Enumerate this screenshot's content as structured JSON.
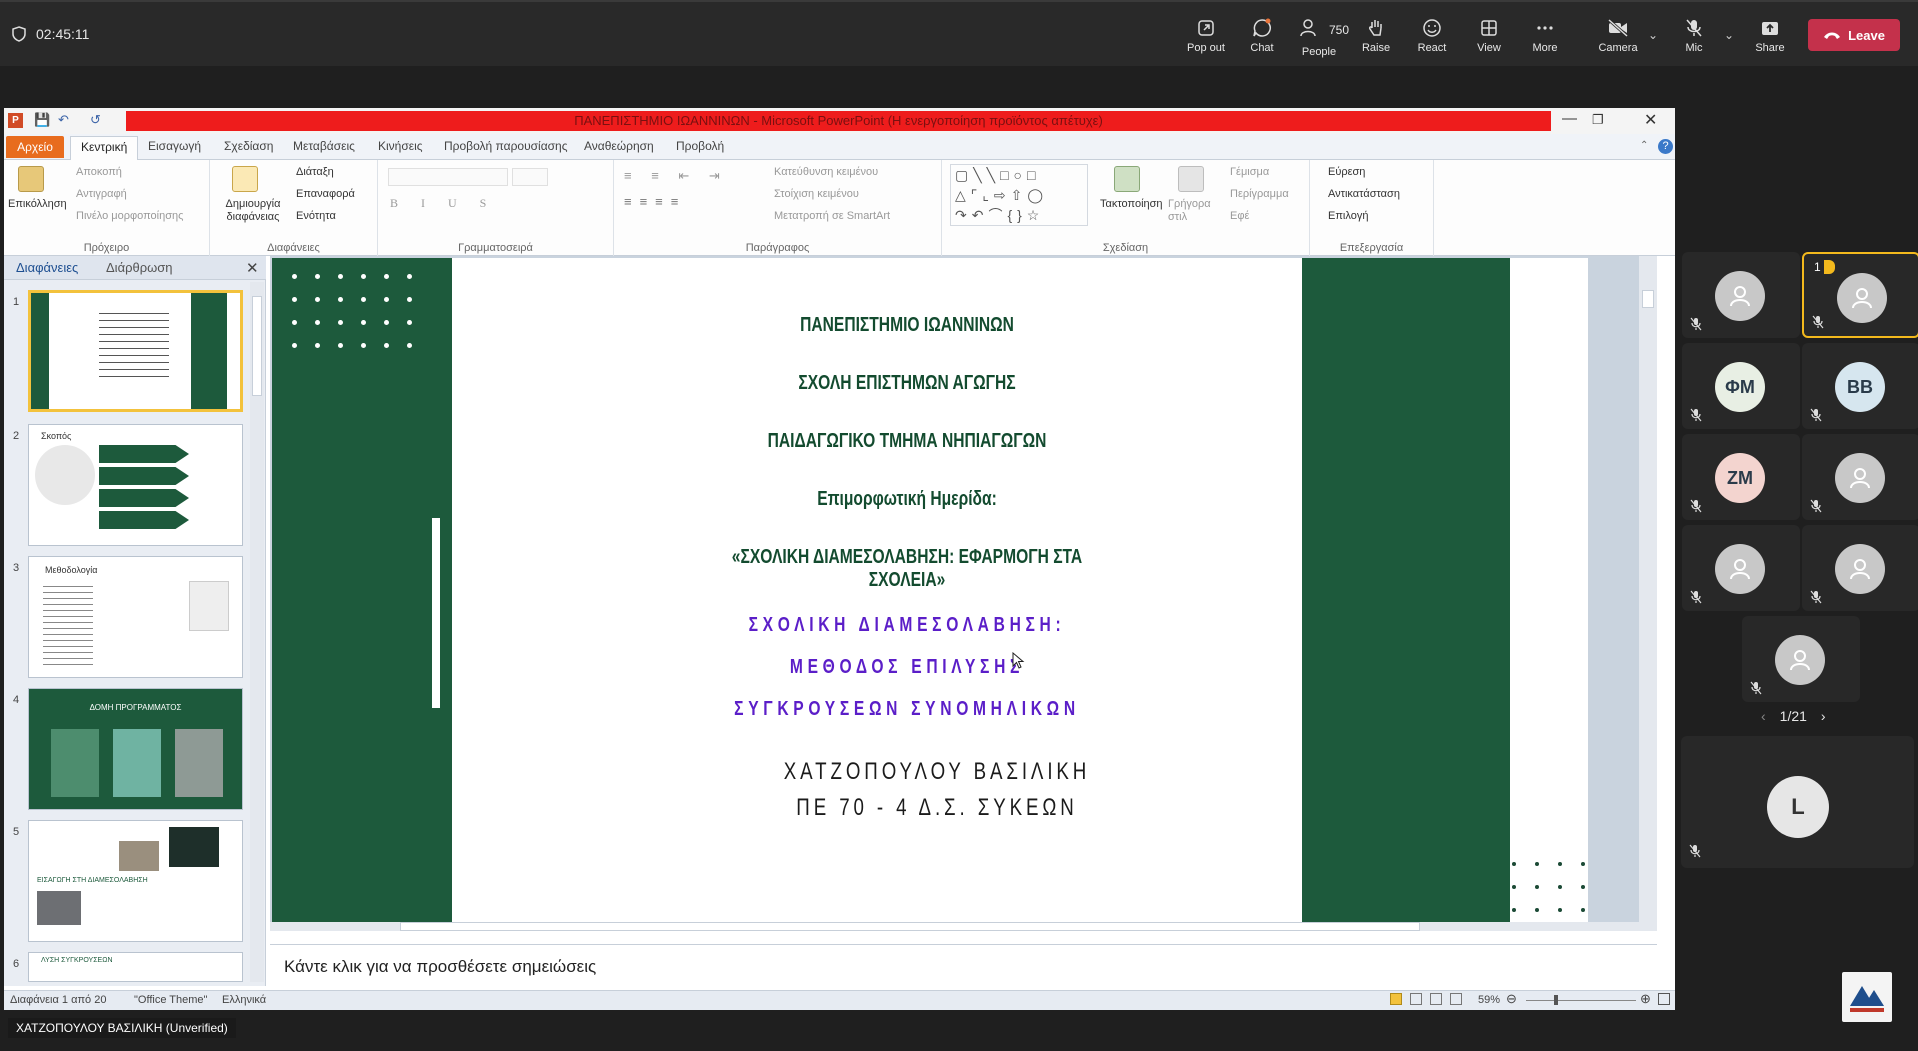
{
  "meeting": {
    "timer": "02:45:11",
    "controls": {
      "popout": "Pop out",
      "chat": "Chat",
      "people": "People",
      "people_count": "750",
      "raise": "Raise",
      "react": "React",
      "view": "View",
      "more": "More",
      "camera": "Camera",
      "mic": "Mic",
      "share": "Share",
      "leave": "Leave"
    },
    "presenter_name": "ΧΑΤΖΟΠΟΥΛΟΥ ΒΑΣΙΛΙΚΗ (Unverified)",
    "participants": [
      {
        "initials": "",
        "hand": "",
        "highlight": false,
        "avatar": "person-icon"
      },
      {
        "initials": "",
        "hand": "1",
        "highlight": true,
        "avatar": "person-icon"
      },
      {
        "initials": "ΦΜ",
        "hand": "",
        "highlight": false,
        "avatar": "initials"
      },
      {
        "initials": "BB",
        "hand": "",
        "highlight": false,
        "avatar": "initials"
      },
      {
        "initials": "ZM",
        "hand": "",
        "highlight": false,
        "avatar": "initials"
      },
      {
        "initials": "",
        "hand": "",
        "highlight": false,
        "avatar": "person-icon"
      },
      {
        "initials": "",
        "hand": "",
        "highlight": false,
        "avatar": "person-icon"
      },
      {
        "initials": "",
        "hand": "",
        "highlight": false,
        "avatar": "person-icon"
      },
      {
        "initials": "",
        "hand": "",
        "highlight": false,
        "avatar": "person-icon"
      }
    ],
    "pager": "1/21",
    "self_initial": "L",
    "colors": {
      "leave": "#c4314b",
      "highlight": "#f3b91d",
      "fm": "#e8efe4",
      "bb": "#d6e6ef",
      "zm": "#f3d4cf"
    }
  },
  "powerpoint": {
    "title": "ΠΑΝΕΠΙΣΤΗΜΙΟ ΙΩΑΝΝΙΝΩΝ - Microsoft PowerPoint (Η ενεργοποίηση προϊόντος απέτυχε)",
    "tabs": [
      "Αρχείο",
      "Κεντρική",
      "Εισαγωγή",
      "Σχεδίαση",
      "Μεταβάσεις",
      "Κινήσεις",
      "Προβολή παρουσίασης",
      "Αναθεώρηση",
      "Προβολή"
    ],
    "ribbon": {
      "clipboard": {
        "paste": "Επικόλληση",
        "cut": "Αποκοπή",
        "copy": "Αντιγραφή",
        "painter": "Πινέλο μορφοποίησης",
        "label": "Πρόχειρο"
      },
      "slides": {
        "new": "Δημιουργία διαφάνειας",
        "layout": "Διάταξη",
        "reset": "Επαναφορά",
        "section": "Ενότητα",
        "label": "Διαφάνειες"
      },
      "font": {
        "label": "Γραμματοσειρά"
      },
      "paragraph": {
        "direction": "Κατεύθυνση κειμένου",
        "align": "Στοίχιση κειμένου",
        "smartart": "Μετατροπή σε SmartArt",
        "label": "Παράγραφος"
      },
      "drawing": {
        "arrange": "Τακτοποίηση",
        "quick": "Γρήγορα στιλ",
        "fill": "Γέμισμα",
        "outline": "Περίγραμμα",
        "effects": "Εφέ",
        "label": "Σχεδίαση"
      },
      "editing": {
        "find": "Εύρεση",
        "replace": "Αντικατάσταση",
        "select": "Επιλογή",
        "label": "Επεξεργασία"
      }
    },
    "panel_tabs": [
      "Διαφάνειες",
      "Διάρθρωση"
    ],
    "thumbs": [
      {
        "num": "1"
      },
      {
        "num": "2",
        "title": "Σκοπός"
      },
      {
        "num": "3",
        "title": "Μεθοδολογία"
      },
      {
        "num": "4",
        "title": "ΔΟΜΗ ΠΡΟΓΡΑΜΜΑΤΟΣ"
      },
      {
        "num": "5",
        "title": "ΕΙΣΑΓΩΓΗ ΣΤΗ ΔΙΑΜΕΣΟΛΑΒΗΣΗ"
      },
      {
        "num": "6",
        "title": "ΛΥΣΗ ΣΥΓΚΡΟΥΣΕΩΝ"
      }
    ],
    "slide": {
      "lines": [
        "ΠΑΝΕΠΙΣΤΗΜΙΟ ΙΩΑΝΝΙΝΩΝ",
        "ΣΧΟΛΗ ΕΠΙΣΤΗΜΩΝ ΑΓΩΓΗΣ",
        "ΠΑΙΔΑΓΩΓΙΚΟ ΤΜΗΜΑ ΝΗΠΙΑΓΩΓΩΝ",
        "Επιμορφωτική Ημερίδα:",
        "«ΣΧΟΛΙΚΗ ΔΙΑΜΕΣΟΛΑΒΗΣΗ: ΕΦΑΡΜΟΓΗ ΣΤΑ ΣΧΟΛΕΙΑ»"
      ],
      "purple": [
        "ΣΧΟΛΙΚΗ ΔΙΑΜΕΣΟΛΑΒΗΣΗ:",
        "ΜΕΘΟΔΟΣ ΕΠΙΛΥΣΗΣ",
        "ΣΥΓΚΡΟΥΣΕΩΝ ΣΥΝΟΜΗΛΙΚΩΝ"
      ],
      "author": [
        "ΧΑΤΖΟΠΟΥΛΟΥ ΒΑΣΙΛΙΚΗ",
        "ΠΕ 70 - 4 Δ.Σ. ΣΥΚΕΩΝ"
      ],
      "colors": {
        "green": "#1d5a3c",
        "purple": "#5b1ec8"
      }
    },
    "notes_placeholder": "Κάντε κλικ για να προσθέσετε σημειώσεις",
    "status": {
      "slide": "Διαφάνεια 1 από 20",
      "theme": "\"Office Theme\"",
      "lang": "Ελληνικά",
      "zoom": "59%"
    }
  }
}
